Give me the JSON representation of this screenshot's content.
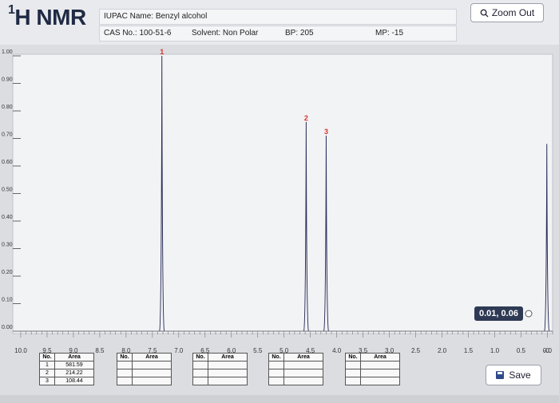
{
  "header": {
    "title_main": "H NMR",
    "title_sup": "1",
    "iupac": "IUPAC Name: Benzyl alcohol",
    "cas": "CAS No.: 100-51-6",
    "solvent": "Solvent: Non Polar",
    "bp": "BP: 205",
    "mp": "MP: -15",
    "zoom_label": "Zoom Out"
  },
  "tooltip": "0.01, 0.06",
  "save_label": "Save",
  "tables": [
    {
      "headers": [
        "No.",
        "Area"
      ],
      "rows": [
        [
          "1",
          "581.59"
        ],
        [
          "2",
          "214.22"
        ],
        [
          "3",
          "108.44"
        ]
      ]
    },
    {
      "headers": [
        "No.",
        "Area"
      ],
      "rows": [
        [
          "",
          ""
        ],
        [
          "",
          ""
        ],
        [
          "",
          ""
        ]
      ]
    },
    {
      "headers": [
        "No.",
        "Area"
      ],
      "rows": [
        [
          "",
          ""
        ],
        [
          "",
          ""
        ],
        [
          "",
          ""
        ]
      ]
    },
    {
      "headers": [
        "No.",
        "Area"
      ],
      "rows": [
        [
          "",
          ""
        ],
        [
          "",
          ""
        ],
        [
          "",
          ""
        ]
      ]
    },
    {
      "headers": [
        "No.",
        "Area"
      ],
      "rows": [
        [
          "",
          ""
        ],
        [
          "",
          ""
        ],
        [
          "",
          ""
        ]
      ]
    }
  ],
  "chart_data": {
    "type": "line",
    "xlim": [
      10.0,
      -0.1
    ],
    "ylim": [
      0,
      1.0
    ],
    "x_ticks": [
      "10.0",
      "9.5",
      "9.0",
      "8.5",
      "8.0",
      "7.5",
      "7.0",
      "6.5",
      "6.0",
      "5.5",
      "5.0",
      "4.5",
      "4.0",
      "3.5",
      "3.0",
      "2.5",
      "2.0",
      "1.5",
      "1.0",
      "0.5",
      "0.0",
      "-0."
    ],
    "y_ticks": [
      "0.00",
      "0.10",
      "0.20",
      "0.30",
      "0.40",
      "0.50",
      "0.60",
      "0.70",
      "0.80",
      "0.90",
      "1.00"
    ],
    "peaks": [
      {
        "label": "1",
        "x": 7.32,
        "y": 1.0
      },
      {
        "label": "2",
        "x": 4.58,
        "y": 0.76
      },
      {
        "label": "3",
        "x": 4.2,
        "y": 0.71
      },
      {
        "label": "",
        "x": 0.01,
        "y": 0.68
      }
    ],
    "cursor": {
      "x": 0.01,
      "y": 0.06
    }
  }
}
